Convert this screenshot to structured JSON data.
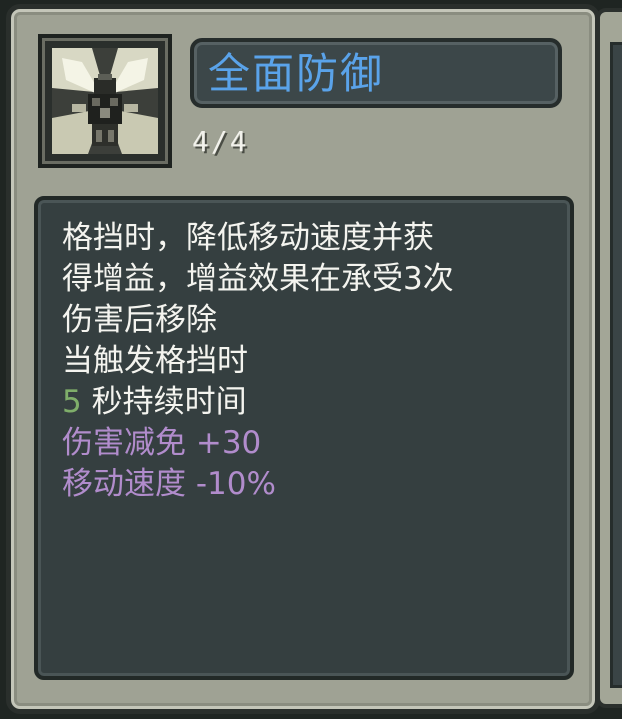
{
  "skill": {
    "title": "全面防御",
    "level": "4/4",
    "icon": "shield-burst-icon"
  },
  "description": {
    "lines": [
      "格挡时，降低移动速度并获",
      "得增益，增益效果在承受3次",
      "伤害后移除",
      "当触发格挡时"
    ],
    "duration_value": "5",
    "duration_label": "秒持续时间",
    "stats": [
      "伤害减免 +30",
      "移动速度 -10%"
    ]
  },
  "colors": {
    "title": "#5aa3ea",
    "duration_value": "#7fae6a",
    "stat": "#b18ccc",
    "panel": "#9fa294",
    "desc_bg": "#353f40"
  }
}
